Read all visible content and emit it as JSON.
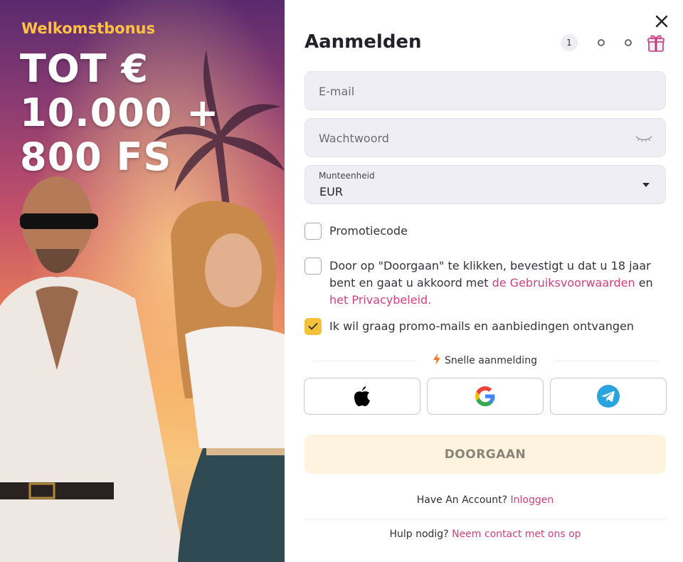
{
  "promo": {
    "title": "Welkomstbonus",
    "amount_line1": "TOT €",
    "amount_line2": "10.000 +",
    "amount_line3": "800 FS"
  },
  "form": {
    "title": "Aanmelden",
    "steps": {
      "current": "1",
      "total_dots": 2
    },
    "email_placeholder": "E-mail",
    "password_placeholder": "Wachtwoord",
    "currency_label": "Munteenheid",
    "currency_value": "EUR",
    "promo_code_label": "Promotiecode",
    "terms": {
      "prefix": "Door op \"Doorgaan\" te klikken, bevestigt u dat u 18 jaar bent en gaat u akkoord met ",
      "terms_link": "de Gebruiksvoorwaarden",
      "middle": " en ",
      "privacy_link": "het Privacybeleid."
    },
    "promo_mails_label": "Ik wil graag promo-mails en aanbiedingen ontvangen",
    "promo_mails_checked": true,
    "quick_signup_label": "Snelle aanmelding",
    "social_buttons": [
      "apple-icon",
      "google-icon",
      "telegram-icon"
    ],
    "continue_label": "DOORGAAN",
    "have_account_text": "Have An Account?",
    "login_link": "Inloggen",
    "help_text": "Hulp nodig?",
    "contact_link": "Neem contact met ons op"
  },
  "colors": {
    "accent_yellow": "#f4c13b",
    "link_pink": "#d13e7f",
    "promo_title": "#ffc244",
    "continue_bg": "#fdf3df"
  }
}
